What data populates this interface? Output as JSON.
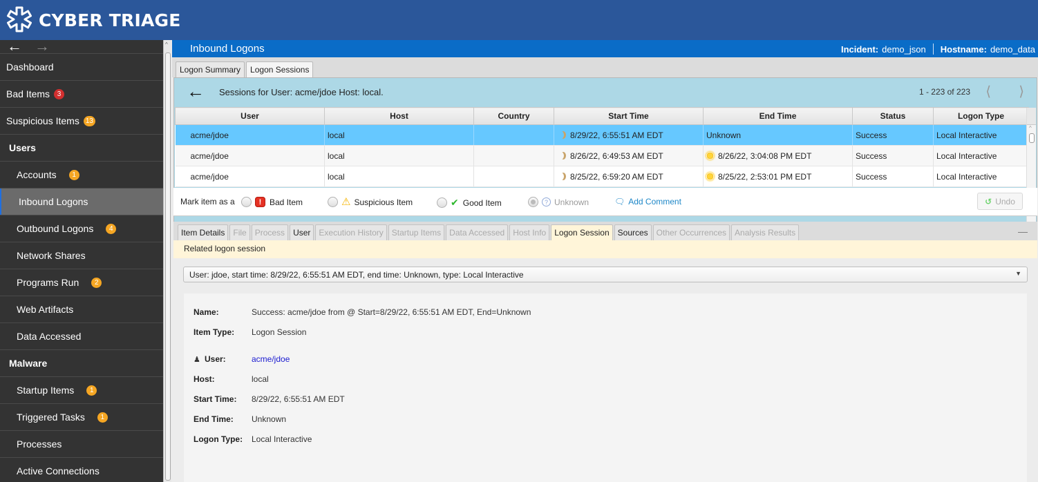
{
  "app": {
    "name": "CYBER TRIAGE",
    "logo_icon": "asterisk-logo-icon"
  },
  "sidebar": {
    "nav": {
      "back_icon": "arrow-left-icon",
      "forward_icon": "arrow-right-icon"
    },
    "items": [
      {
        "label": "Dashboard",
        "level": 0
      },
      {
        "label": "Bad Items",
        "level": 0,
        "badge": "3",
        "badge_color": "#d32f2f"
      },
      {
        "label": "Suspicious Items",
        "level": 0,
        "badge": "13",
        "badge_color": "#f5a623"
      },
      {
        "label": "Users",
        "level": "header"
      },
      {
        "label": "Accounts",
        "level": 1,
        "badge": "1",
        "badge_color": "#f5a623"
      },
      {
        "label": "Inbound Logons",
        "level": 1,
        "active": true
      },
      {
        "label": "Outbound Logons",
        "level": 1,
        "badge": "4",
        "badge_color": "#f5a623"
      },
      {
        "label": "Network Shares",
        "level": 1
      },
      {
        "label": "Programs Run",
        "level": 1,
        "badge": "2",
        "badge_color": "#f5a623"
      },
      {
        "label": "Web Artifacts",
        "level": 1
      },
      {
        "label": "Data Accessed",
        "level": 1
      },
      {
        "label": "Malware",
        "level": "header"
      },
      {
        "label": "Startup Items",
        "level": 1,
        "badge": "1",
        "badge_color": "#f5a623"
      },
      {
        "label": "Triggered Tasks",
        "level": 1,
        "badge": "1",
        "badge_color": "#f5a623"
      },
      {
        "label": "Processes",
        "level": 1
      },
      {
        "label": "Active Connections",
        "level": 1
      }
    ]
  },
  "header": {
    "title": "Inbound Logons",
    "incident_label": "Incident:",
    "incident_value": "demo_json",
    "hostname_label": "Hostname:",
    "hostname_value": "demo_data"
  },
  "top_tabs": [
    {
      "label": "Logon Summary",
      "selected": false
    },
    {
      "label": "Logon Sessions",
      "selected": true
    }
  ],
  "sessions": {
    "heading": "Sessions for User: acme/jdoe Host: local.",
    "pager": "1 - 223 of 223",
    "columns": [
      "User",
      "Host",
      "Country",
      "Start Time",
      "End Time",
      "Status",
      "Logon Type"
    ],
    "rows": [
      {
        "user": "acme/jdoe",
        "host": "local",
        "country": "",
        "start_icon": "moon-icon",
        "start": "8/29/22, 6:55:51 AM EDT",
        "end_icon": "",
        "end": "Unknown",
        "status": "Success",
        "logon_type": "Local Interactive",
        "selected": true
      },
      {
        "user": "acme/jdoe",
        "host": "local",
        "country": "",
        "start_icon": "moon-icon",
        "start": "8/26/22, 6:49:53 AM EDT",
        "end_icon": "sun-icon",
        "end": "8/26/22, 3:04:08 PM EDT",
        "status": "Success",
        "logon_type": "Local Interactive",
        "selected": false
      },
      {
        "user": "acme/jdoe",
        "host": "local",
        "country": "",
        "start_icon": "moon-icon",
        "start": "8/25/22, 6:59:20 AM EDT",
        "end_icon": "sun-icon",
        "end": "8/25/22, 2:53:01 PM EDT",
        "status": "Success",
        "logon_type": "Local Interactive",
        "selected": false
      }
    ]
  },
  "mark_bar": {
    "label": "Mark item as a",
    "options": [
      {
        "label": "Bad Item",
        "icon": "bad-item-icon",
        "checked": false
      },
      {
        "label": "Suspicious Item",
        "icon": "warning-icon",
        "checked": false
      },
      {
        "label": "Good Item",
        "icon": "checkmark-icon",
        "checked": false
      },
      {
        "label": "Unknown",
        "icon": "question-icon",
        "checked": true
      }
    ],
    "add_comment": "Add Comment",
    "undo": "Undo"
  },
  "detail_tabs": [
    {
      "label": "Item Details",
      "enabled": true
    },
    {
      "label": "File",
      "enabled": false
    },
    {
      "label": "Process",
      "enabled": false
    },
    {
      "label": "User",
      "enabled": true
    },
    {
      "label": "Execution History",
      "enabled": false
    },
    {
      "label": "Startup Items",
      "enabled": false
    },
    {
      "label": "Data Accessed",
      "enabled": false
    },
    {
      "label": "Host Info",
      "enabled": false
    },
    {
      "label": "Logon Session",
      "enabled": true,
      "selected": true
    },
    {
      "label": "Sources",
      "enabled": true
    },
    {
      "label": "Other Occurrences",
      "enabled": false
    },
    {
      "label": "Analysis Results",
      "enabled": false
    }
  ],
  "detail": {
    "related_label": "Related logon session",
    "session_select": "User: jdoe, start time: 8/29/22, 6:55:51 AM EDT, end time: Unknown, type: Local Interactive",
    "fields": [
      {
        "key": "Name:",
        "value": "Success: acme/jdoe from @ Start=8/29/22, 6:55:51 AM EDT, End=Unknown"
      },
      {
        "key": "Item Type:",
        "value": "Logon Session"
      },
      {
        "key": "User:",
        "value": "acme/jdoe",
        "link": true,
        "icon": "user-icon"
      },
      {
        "key": "Host:",
        "value": "local"
      },
      {
        "key": "Start Time:",
        "value": "8/29/22, 6:55:51 AM EDT"
      },
      {
        "key": "End Time:",
        "value": "Unknown"
      },
      {
        "key": "Logon Type:",
        "value": "Local Interactive"
      }
    ]
  }
}
